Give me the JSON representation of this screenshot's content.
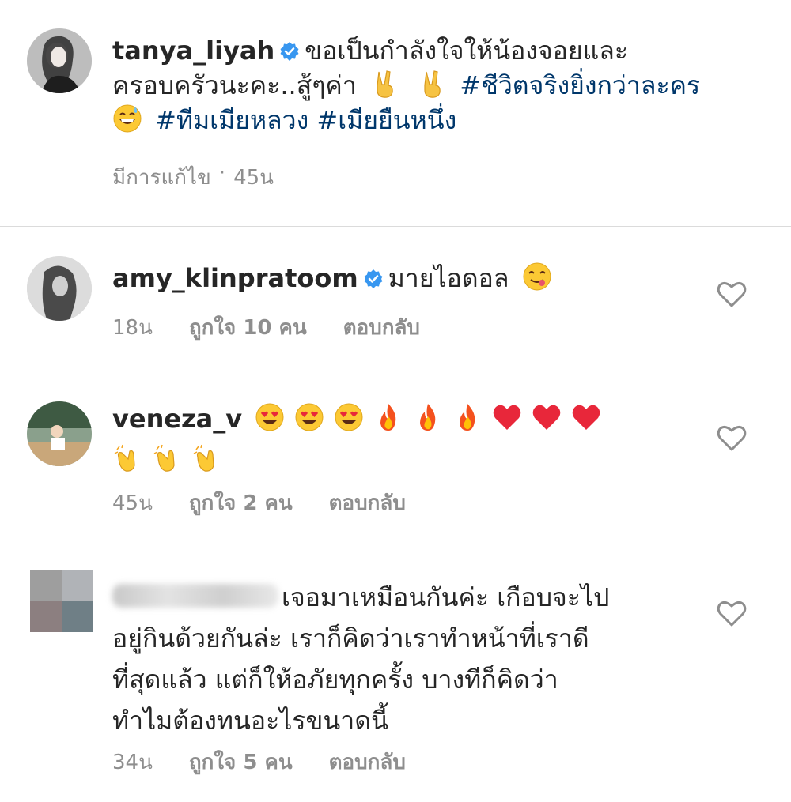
{
  "colors": {
    "hashtag": "#00376b",
    "meta_text": "#8e8e8e",
    "verified_blue": "#3897f0",
    "divider": "#dbdbdb"
  },
  "caption": {
    "username": "tanya_liyah",
    "verified": true,
    "line1": "ขอเป็นกำลังใจให้น้องจอยและ",
    "line2_text": "ครอบครัวนะคะ..สู้ๆค่า",
    "emoji_1": "victory-hand",
    "emoji_2": "victory-hand",
    "hashtag_1": "#ชีวิตจริงยิ่งกว่าละคร",
    "emoji_3": "grinning-sweat",
    "hashtag_2": "#ทีมเมียหลวง",
    "hashtag_3": "#เมียยืนหนึ่ง",
    "edited_label": "มีการแก้ไข",
    "separator": "·",
    "time": "45น"
  },
  "comments": [
    {
      "username": "amy_klinpratoom",
      "verified": true,
      "text": "มายไอดอล",
      "emoji": "yum-face",
      "time": "18น",
      "likes": "ถูกใจ 10 คน",
      "reply": "ตอบกลับ"
    },
    {
      "username": "veneza_v",
      "verified": false,
      "emojis_line1": [
        "heart-eyes",
        "heart-eyes",
        "heart-eyes",
        "fire",
        "fire",
        "fire",
        "red-heart",
        "red-heart",
        "red-heart"
      ],
      "emojis_line2": [
        "clapping-hands",
        "clapping-hands",
        "clapping-hands"
      ],
      "time": "45น",
      "likes": "ถูกใจ 2 คน",
      "reply": "ตอบกลับ"
    },
    {
      "username_hidden": true,
      "line1": "เจอมาเหมือนกันค่ะ เกือบจะไป",
      "line2": "อยู่กินด้วยกันล่ะ เราก็คิดว่าเราทำหน้าที่เราดี",
      "line3": "ที่สุดแล้ว แต่ก็ให้อภัยทุกครั้ง บางทีก็คิดว่า",
      "line4": "ทำไมต้องทนอะไรขนาดนี้",
      "time": "34น",
      "likes": "ถูกใจ 5 คน",
      "reply": "ตอบกลับ"
    }
  ]
}
